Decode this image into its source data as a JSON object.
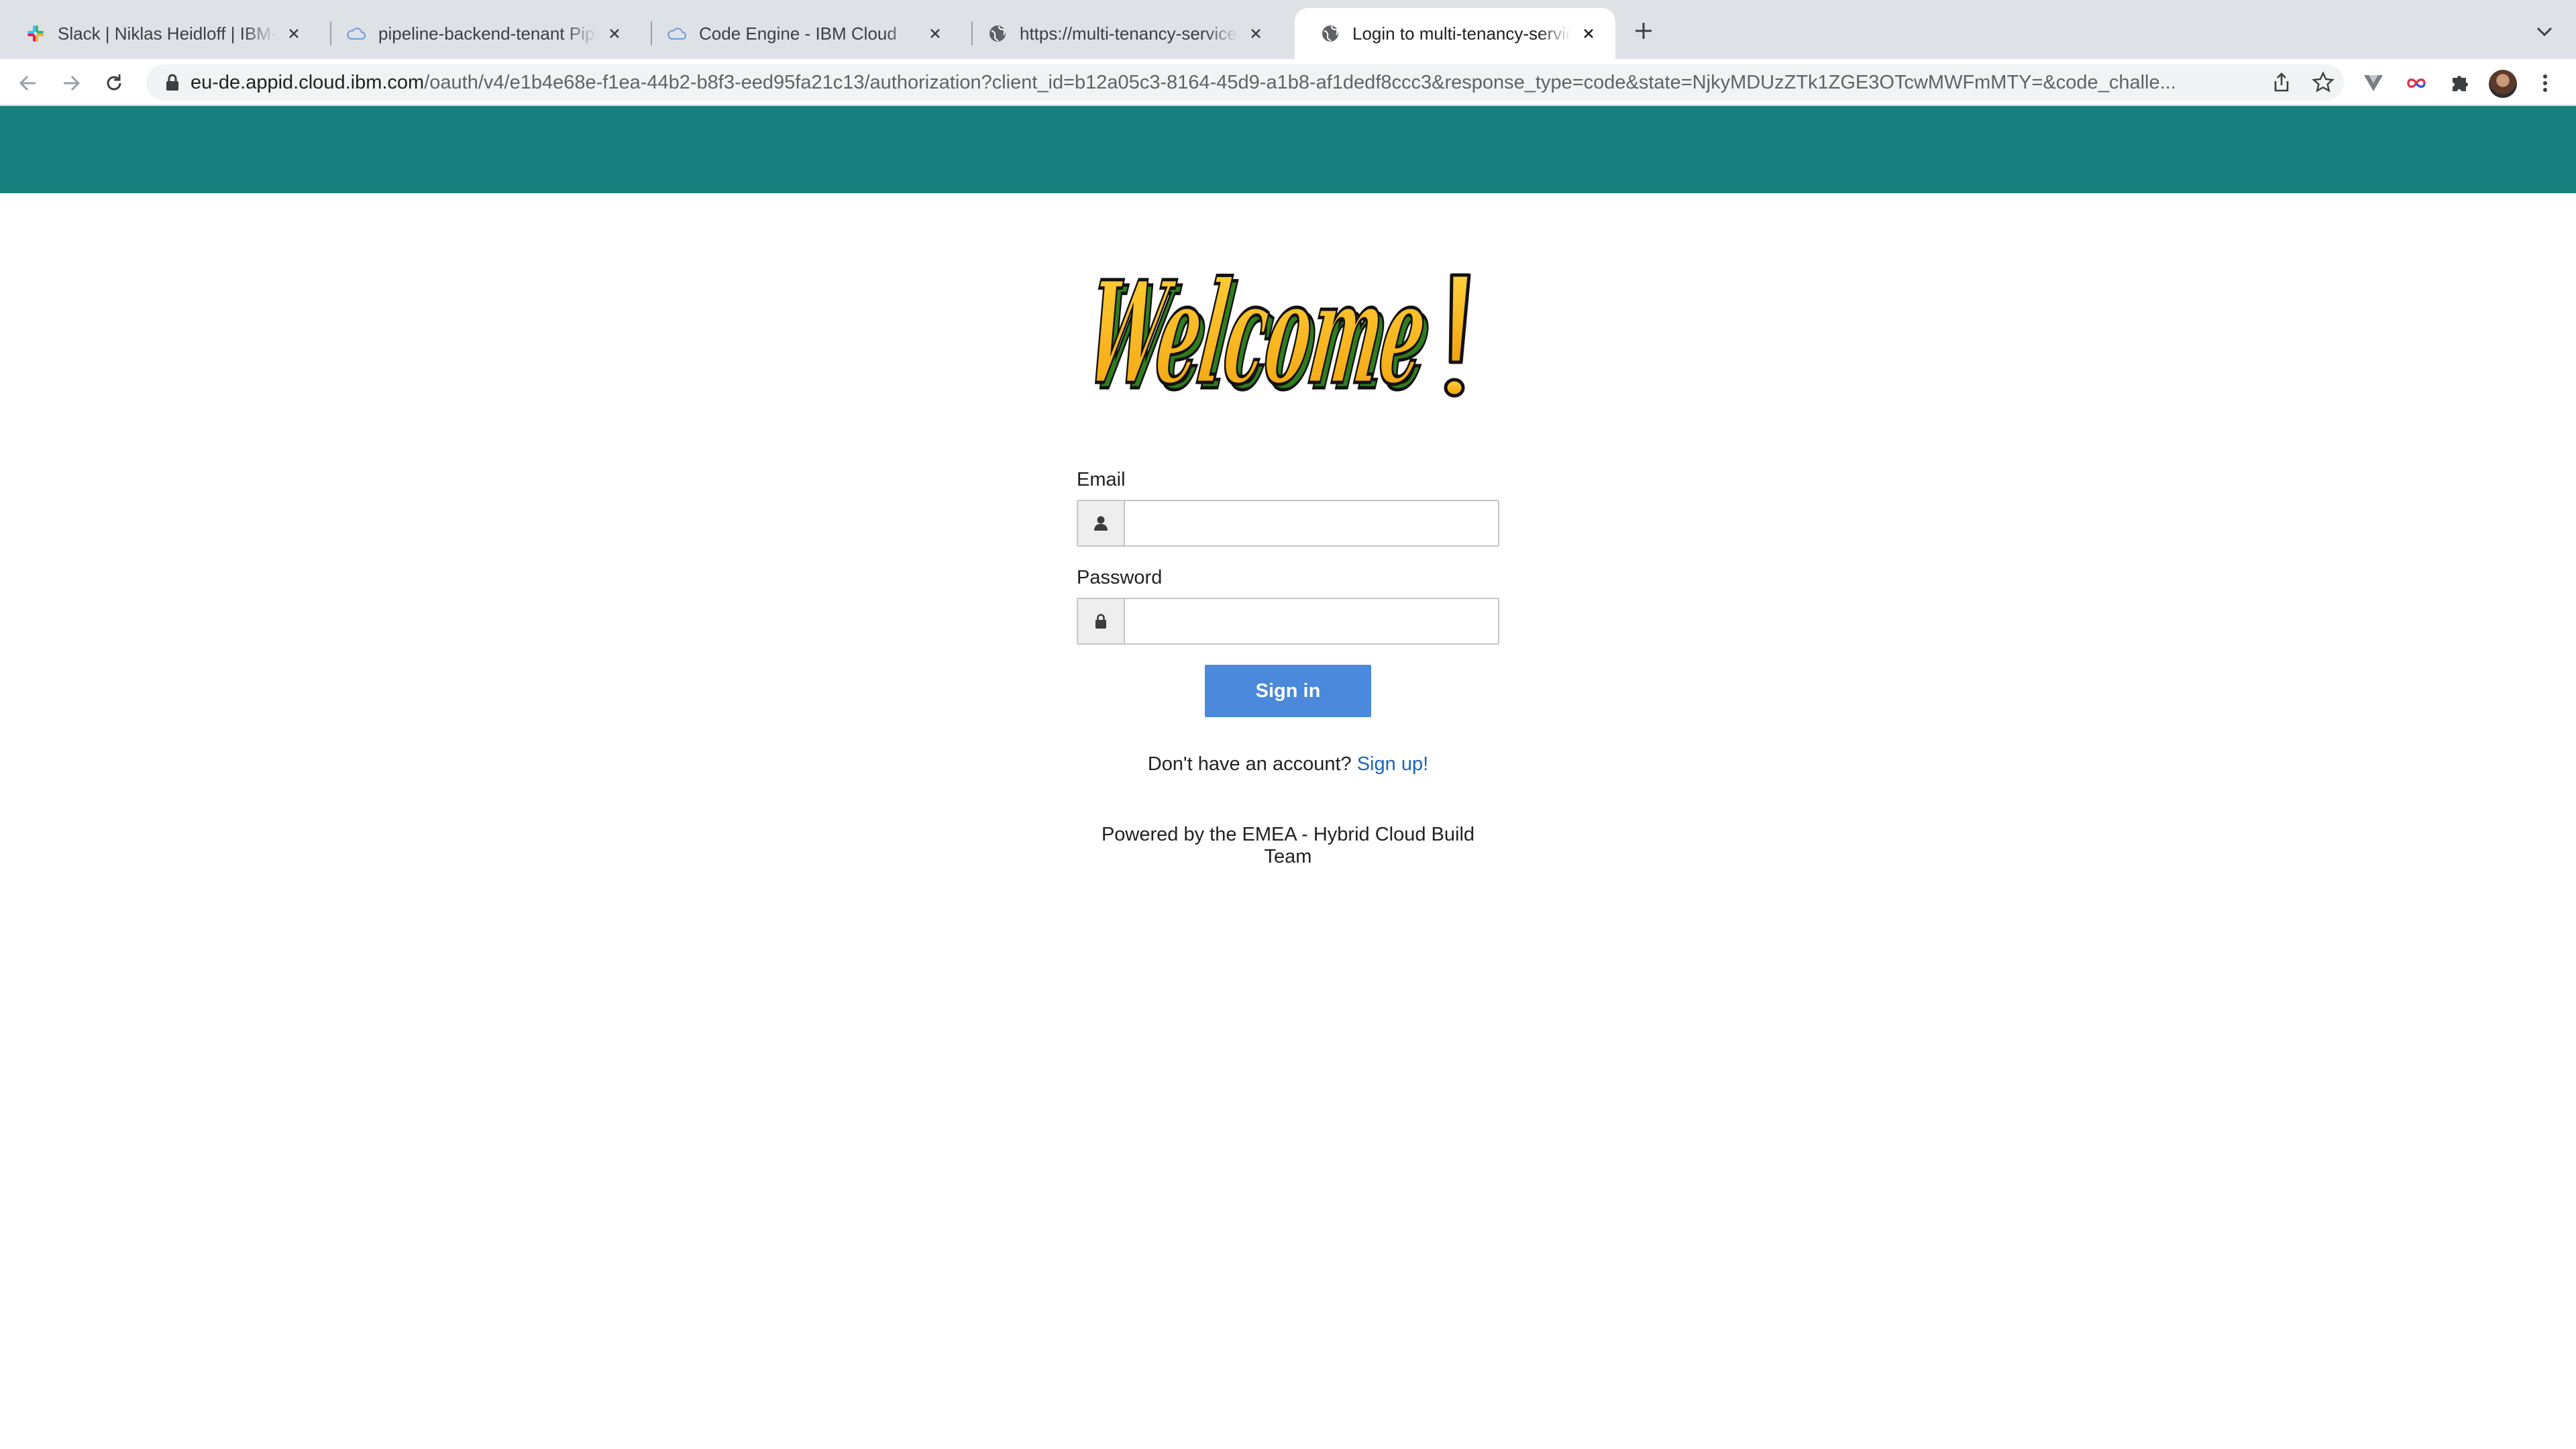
{
  "browser": {
    "tabs": [
      {
        "title": "Slack | Niklas Heidloff | IBM-Cl",
        "icon": "slack-icon"
      },
      {
        "title": "pipeline-backend-tenant Pipeli",
        "icon": "cloud-icon"
      },
      {
        "title": "Code Engine - IBM Cloud",
        "icon": "cloud-icon"
      },
      {
        "title": "https://multi-tenancy-service-b",
        "icon": "globe-icon"
      },
      {
        "title": "Login to multi-tenancy-service",
        "icon": "globe-icon",
        "active": true
      }
    ],
    "address_bar": {
      "host": "eu-de.appid.cloud.ibm.com",
      "path": "/oauth/v4/e1b4e68e-f1ea-44b2-b8f3-eed95fa21c13/authorization?client_id=b12a05c3-8164-45d9-a1b8-af1dedf8ccc3&response_type=code&state=NjkyMDUzZTk1ZGE3OTcwMWFmMTY=&code_challe..."
    }
  },
  "page": {
    "header_color": "#17807e",
    "logo_text": "Welcome!",
    "email": {
      "label": "Email",
      "value": "",
      "placeholder": ""
    },
    "password": {
      "label": "Password",
      "value": "",
      "placeholder": ""
    },
    "signin_label": "Sign in",
    "signup_prompt": "Don't have an account?",
    "signup_link": "Sign up!",
    "powered_by": "Powered by the EMEA - Hybrid Cloud Build Team"
  },
  "colors": {
    "accent": "#4a89dc",
    "link": "#1a66b8",
    "logo_yellow": "#f5b417",
    "logo_green": "#2f7d1e"
  }
}
